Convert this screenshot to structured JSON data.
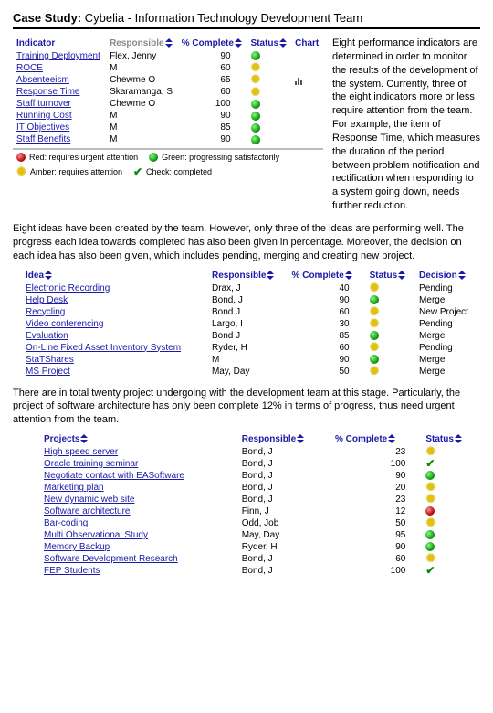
{
  "title": {
    "strong": "Case Study:",
    "rest": " Cybelia - Information Technology Development Team"
  },
  "intro_right": "Eight performance indicators are determined in order to monitor the results of the development of the system. Currently, three of the eight indicators more or less require attention from the team. For example, the item of Response Time, which measures the duration of the period between problem notification and rectification when responding to a system going down, needs further reduction.",
  "table1": {
    "headers": {
      "indicator": "Indicator",
      "responsible": "Responsible",
      "pct": "% Complete",
      "status": "Status",
      "chart": "Chart"
    },
    "rows": [
      {
        "indicator": "Training Deployment",
        "responsible": "Flex, Jenny",
        "pct": "90",
        "status": "green"
      },
      {
        "indicator": "ROCE",
        "responsible": "M",
        "pct": "60",
        "status": "amber"
      },
      {
        "indicator": "Absenteeism",
        "responsible": "Chewme O",
        "pct": "65",
        "status": "amber",
        "chart": true
      },
      {
        "indicator": "Response Time",
        "responsible": "Skaramanga, S",
        "pct": "60",
        "status": "amber"
      },
      {
        "indicator": "Staff turnover",
        "responsible": "Chewme O",
        "pct": "100",
        "status": "green"
      },
      {
        "indicator": "Running Cost",
        "responsible": "M",
        "pct": "90",
        "status": "green"
      },
      {
        "indicator": "IT Objectives",
        "responsible": "M",
        "pct": "85",
        "status": "green"
      },
      {
        "indicator": "Staff Benefits",
        "responsible": "M",
        "pct": "90",
        "status": "green"
      }
    ]
  },
  "legend": {
    "red": "Red: requires urgent attention",
    "green": "Green: progressing satisfactorily",
    "amber": "Amber: requires attention",
    "check": "Check: completed"
  },
  "para2": "Eight ideas have been created by the team. However, only three of the ideas are performing well. The progress each idea towards completed has also been given in percentage. Moreover, the decision on each idea has also been given, which includes pending, merging and creating new project.",
  "table2": {
    "headers": {
      "idea": "Idea",
      "responsible": "Responsible",
      "pct": "% Complete",
      "status": "Status",
      "decision": "Decision"
    },
    "rows": [
      {
        "idea": "Electronic Recording",
        "responsible": "Drax, J",
        "pct": "40",
        "status": "amber",
        "decision": "Pending"
      },
      {
        "idea": "Help Desk",
        "responsible": "Bond, J",
        "pct": "90",
        "status": "green",
        "decision": "Merge"
      },
      {
        "idea": "Recycling",
        "responsible": "Bond J",
        "pct": "60",
        "status": "amber",
        "decision": "New Project"
      },
      {
        "idea": "Video conferencing",
        "responsible": "Largo, I",
        "pct": "30",
        "status": "amber",
        "decision": "Pending"
      },
      {
        "idea": "Evaluation",
        "responsible": "Bond J",
        "pct": "85",
        "status": "green",
        "decision": "Merge"
      },
      {
        "idea": "On-Line Fixed Asset Inventory System",
        "responsible": "Ryder, H",
        "pct": "60",
        "status": "amber",
        "decision": "Pending"
      },
      {
        "idea": "StaTShares",
        "responsible": "M",
        "pct": "90",
        "status": "green",
        "decision": "Merge"
      },
      {
        "idea": "MS Project",
        "responsible": "May, Day",
        "pct": "50",
        "status": "amber",
        "decision": "Merge"
      }
    ]
  },
  "para3": "There are in total twenty project undergoing with the development team at this stage. Particularly, the project of software architecture has only been complete 12% in terms of progress, thus need urgent attention from the team.",
  "table3": {
    "headers": {
      "project": "Projects",
      "responsible": "Responsible",
      "pct": "% Complete",
      "status": "Status"
    },
    "rows": [
      {
        "project": "High speed server",
        "responsible": "Bond, J",
        "pct": "23",
        "status": "amber"
      },
      {
        "project": "Oracle training seminar",
        "responsible": "Bond, J",
        "pct": "100",
        "status": "check"
      },
      {
        "project": "Negotiate contact with EASoftware",
        "responsible": "Bond, J",
        "pct": "90",
        "status": "green"
      },
      {
        "project": "Marketing plan",
        "responsible": "Bond, J",
        "pct": "20",
        "status": "amber"
      },
      {
        "project": "New dynamic web site",
        "responsible": "Bond, J",
        "pct": "23",
        "status": "amber"
      },
      {
        "project": "Software architecture",
        "responsible": "Finn, J",
        "pct": "12",
        "status": "red"
      },
      {
        "project": "Bar-coding",
        "responsible": "Odd, Job",
        "pct": "50",
        "status": "amber"
      },
      {
        "project": "Multi Observational Study",
        "responsible": "May, Day",
        "pct": "95",
        "status": "green"
      },
      {
        "project": "Memory Backup",
        "responsible": "Ryder, H",
        "pct": "90",
        "status": "green"
      },
      {
        "project": "Software Development Research",
        "responsible": "Bond, J",
        "pct": "60",
        "status": "amber"
      },
      {
        "project": "FEP Students",
        "responsible": "Bond, J",
        "pct": "100",
        "status": "check"
      }
    ]
  }
}
